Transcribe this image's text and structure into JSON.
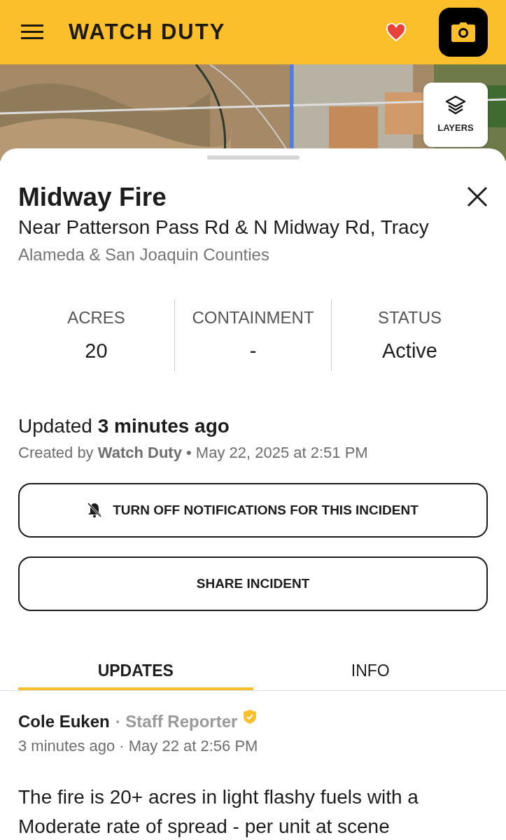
{
  "app_bar": {
    "title": "WATCH DUTY",
    "favorite": true
  },
  "map": {
    "kind": "picture",
    "layers_button": "LAYERS"
  },
  "incident": {
    "name": "Midway Fire",
    "location": "Near Patterson Pass Rd & N Midway Rd, Tracy",
    "counties": "Alameda & San Joaquin Counties"
  },
  "stats": [
    {
      "label": "ACRES",
      "value": "20"
    },
    {
      "label": "CONTAINMENT",
      "value": "-"
    },
    {
      "label": "STATUS",
      "value": "Active"
    }
  ],
  "updated": "Updated **3 minutes ago**",
  "created": "Created by **Watch Duty** • May 22, 2025 at 2:51 PM",
  "buttons": [
    {
      "kind": "notifications-off",
      "label": "TURN OFF NOTIFICATIONS FOR THIS INCIDENT"
    },
    {
      "kind": "plain",
      "label": "SHARE INCIDENT"
    }
  ],
  "tabs": [
    {
      "label": "UPDATES",
      "selected": true
    },
    {
      "label": "INFO",
      "selected": false
    }
  ],
  "posts": [
    {
      "author": "Cole Euken",
      "role": "· Staff Reporter",
      "verified": true,
      "time": "3 minutes ago · May 22 at 2:56 PM",
      "text": "The fire is 20+ acres in light flashy fuels with a Moderate rate of spread - per unit at scene"
    }
  ]
}
